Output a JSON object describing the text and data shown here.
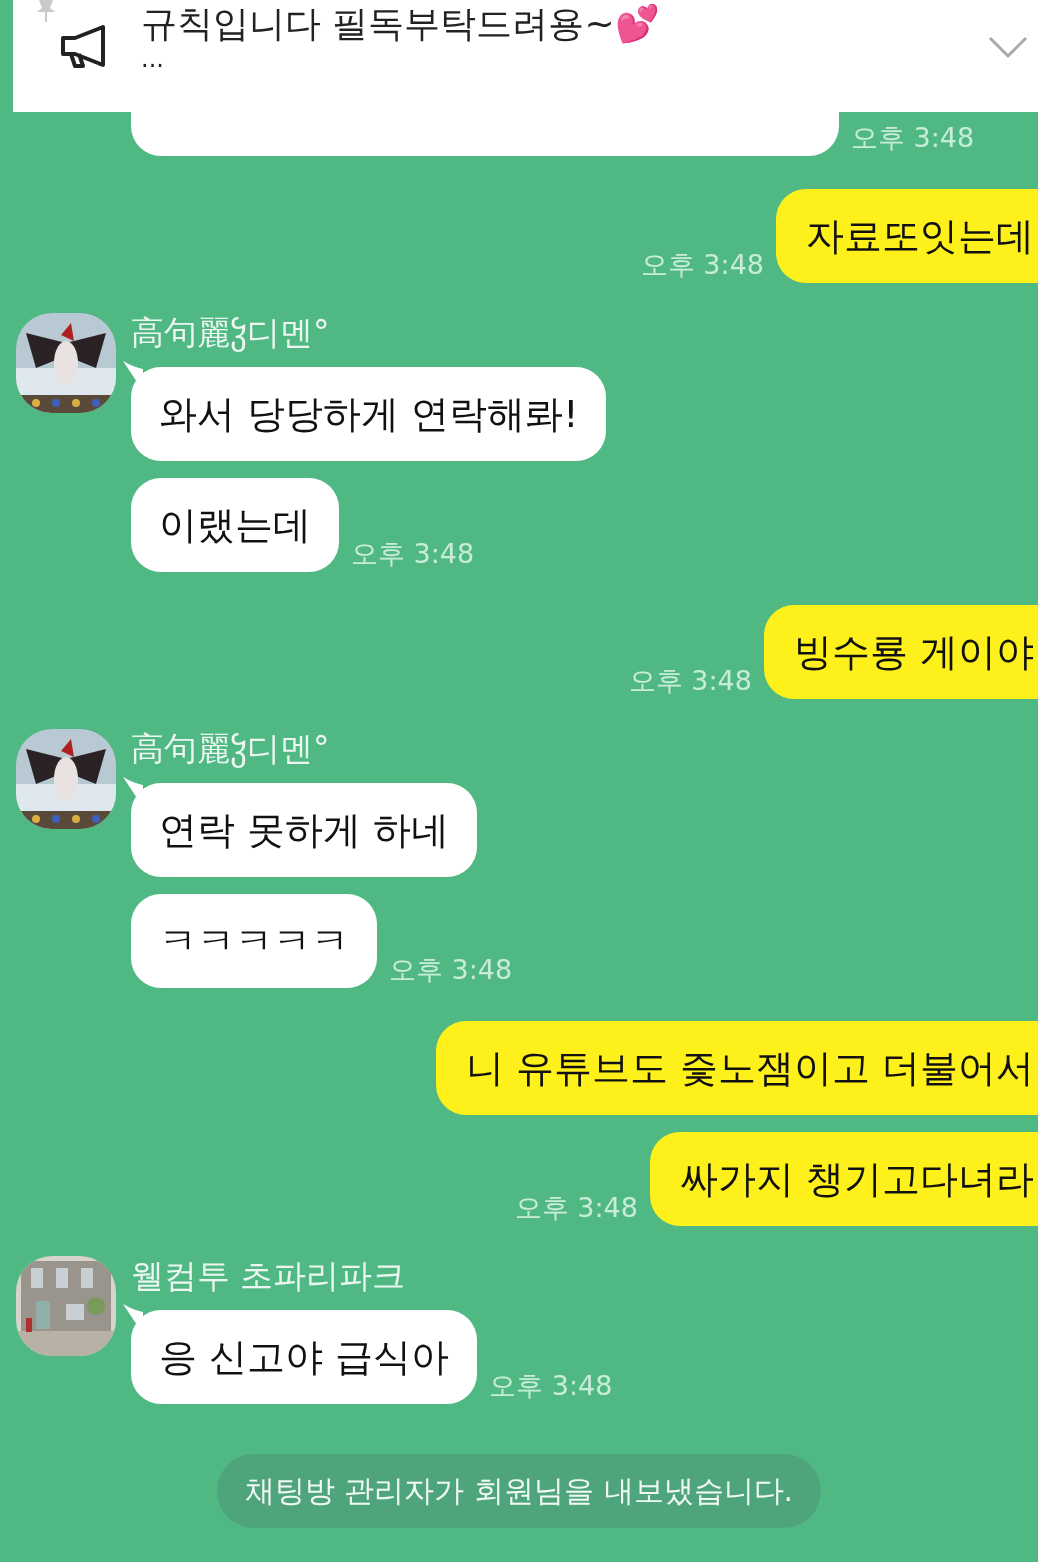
{
  "notice": {
    "title": "규칙입니다 필독부탁드려용~💕",
    "more": "..."
  },
  "messages": [
    {
      "kind": "clipped",
      "time": "오후 3:48"
    },
    {
      "kind": "sent",
      "bubbles": [
        "자료또잇는데"
      ],
      "time": "오후 3:48"
    },
    {
      "kind": "received",
      "sender": "高句麗ჴ디멘°",
      "bubbles": [
        "와서 당당하게 연락해롸!",
        "이랬는데"
      ],
      "time": "오후 3:48"
    },
    {
      "kind": "sent",
      "bubbles": [
        "빙수룡 게이야"
      ],
      "time": "오후 3:48"
    },
    {
      "kind": "received",
      "sender": "高句麗ჴ디멘°",
      "bubbles": [
        "연락 못하게 하네",
        "ㅋㅋㅋㅋㅋ"
      ],
      "time": "오후 3:48"
    },
    {
      "kind": "sent",
      "bubbles": [
        "니 유튜브도 즟노잼이고 더불어서",
        "싸가지 챙기고다녀라"
      ],
      "time": "오후 3:48"
    },
    {
      "kind": "received",
      "sender": "웰컴투 초파리파크",
      "bubbles": [
        "응 신고야 급식아"
      ],
      "time": "오후 3:48"
    }
  ],
  "system": "채팅방 관리자가 회원님을 내보냈습니다."
}
